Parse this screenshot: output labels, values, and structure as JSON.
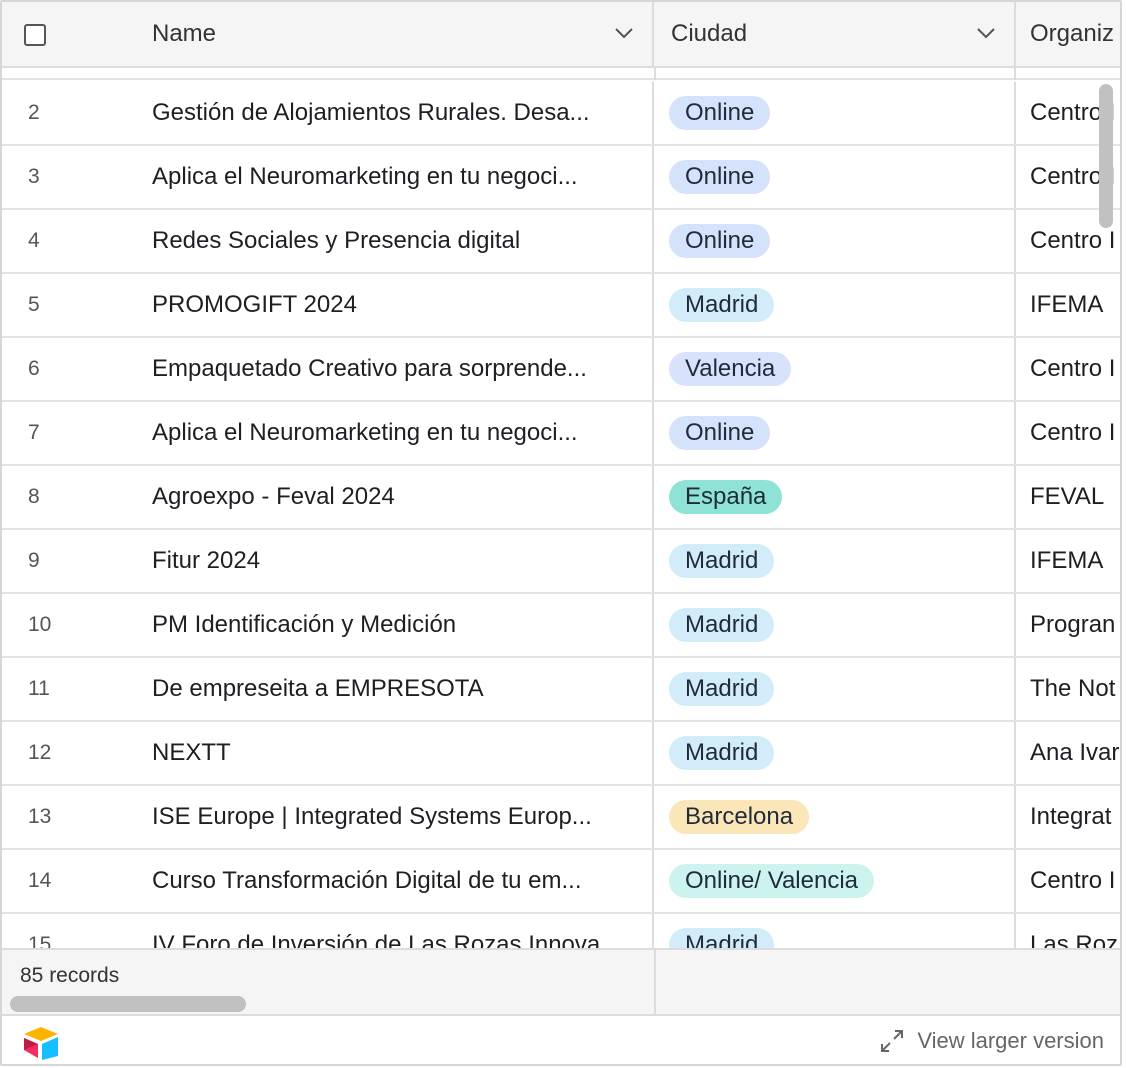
{
  "header": {
    "columns": [
      "Name",
      "Ciudad",
      "Organiz"
    ]
  },
  "rows": [
    {
      "num": "2",
      "name": "Gestión de Alojamientos Rurales. Desa...",
      "city": "Online",
      "org": "Centro I",
      "pill": "#d4e2fb"
    },
    {
      "num": "3",
      "name": "Aplica el Neuromarketing en tu negoci...",
      "city": "Online",
      "org": "Centro I",
      "pill": "#d4e2fb"
    },
    {
      "num": "4",
      "name": "Redes Sociales y Presencia digital",
      "city": "Online",
      "org": "Centro I",
      "pill": "#d4e2fb"
    },
    {
      "num": "5",
      "name": "PROMOGIFT 2024",
      "city": "Madrid",
      "org": "IFEMA",
      "pill": "#d2ecfa"
    },
    {
      "num": "6",
      "name": "Empaquetado Creativo para sorprende...",
      "city": "Valencia",
      "org": "Centro I",
      "pill": "#d8e2fb"
    },
    {
      "num": "7",
      "name": "Aplica el Neuromarketing en tu negoci...",
      "city": "Online",
      "org": "Centro I",
      "pill": "#d4e2fb"
    },
    {
      "num": "8",
      "name": "Agroexpo - Feval 2024",
      "city": "España",
      "org": "FEVAL",
      "pill": "#8fe2d6"
    },
    {
      "num": "9",
      "name": "Fitur 2024",
      "city": "Madrid",
      "org": "IFEMA",
      "pill": "#d2ecfa"
    },
    {
      "num": "10",
      "name": "PM Identificación y Medición",
      "city": "Madrid",
      "org": "Progran",
      "pill": "#d2ecfa"
    },
    {
      "num": "11",
      "name": "De empreseita a EMPRESOTA",
      "city": "Madrid",
      "org": "The Not",
      "pill": "#d2ecfa"
    },
    {
      "num": "12",
      "name": "NEXTT",
      "city": "Madrid",
      "org": "Ana Ivar",
      "pill": "#d2ecfa"
    },
    {
      "num": "13",
      "name": "ISE Europe | Integrated Systems Europ...",
      "city": "Barcelona",
      "org": "Integrat",
      "pill": "#fbe6b8"
    },
    {
      "num": "14",
      "name": "Curso Transformación Digital de tu em...",
      "city": "Online/ Valencia",
      "org": "Centro I",
      "pill": "#cdf3ef"
    },
    {
      "num": "15",
      "name": "IV Foro de Inversión de Las Rozas Innova",
      "city": "Madrid",
      "org": "Las Roz",
      "pill": "#d2ecfa"
    }
  ],
  "footer": {
    "records": "85 records",
    "view_larger": "View larger version"
  }
}
